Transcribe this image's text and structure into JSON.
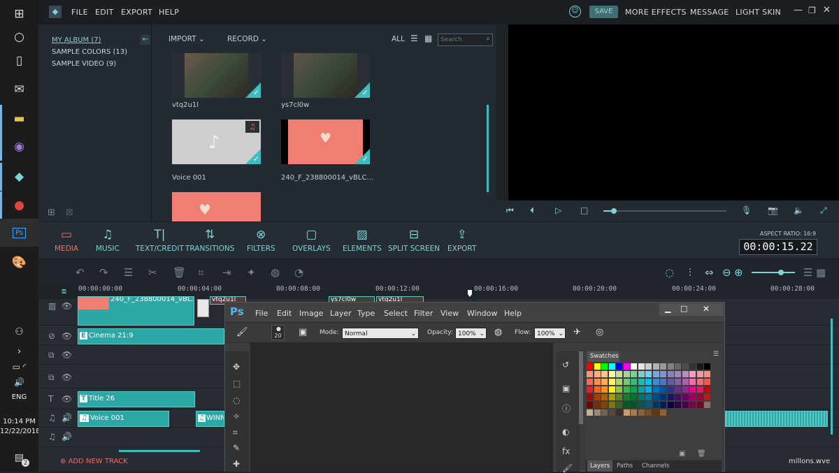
{
  "taskbar": {
    "lang": "ENG",
    "time": "10:14 PM",
    "date": "12/22/2018",
    "badge": "2"
  },
  "topbar": {
    "menus": [
      "FILE",
      "EDIT",
      "EXPORT",
      "HELP"
    ],
    "save": "SAVE",
    "more_effects": "MORE EFFECTS",
    "message": "MESSAGE",
    "light_skin": "LIGHT SKIN"
  },
  "album": {
    "items": [
      "MY ALBUM (7)",
      "SAMPLE COLORS (13)",
      "SAMPLE VIDEO (9)"
    ]
  },
  "media": {
    "import": "IMPORT",
    "record": "RECORD",
    "all": "ALL",
    "search_placeholder": "Search",
    "items": [
      {
        "caption": "vtq2u1l"
      },
      {
        "caption": "ys7cl0w"
      },
      {
        "caption": "Voice 001"
      },
      {
        "caption": "240_F_238800014_vBLC..."
      }
    ]
  },
  "tools": {
    "tabs": [
      "MEDIA",
      "MUSIC",
      "TEXT/CREDIT",
      "TRANSITIONS",
      "FILTERS",
      "OVERLAYS",
      "ELEMENTS",
      "SPLIT SCREEN",
      "EXPORT"
    ],
    "aspect_ratio": "ASPECT RATIO: 16:9",
    "timecode": "00:00:15.22"
  },
  "ruler": {
    "ticks": [
      "00:00:00:00",
      "00:00:04:00",
      "00:00:08:00",
      "00:00:12:00",
      "00:00:16:00",
      "00:00:20:00",
      "00:00:24:00",
      "00:00:28:00"
    ]
  },
  "clips": {
    "video1": "240_F_238800014_vBL...",
    "video1b": "vtq2u1l",
    "video1c": "ys7cl0w",
    "video1d": "vtq2u1l",
    "overlay": "Cinema 21:9",
    "title": "Title 26",
    "voice": "Voice 001",
    "music2": "WINN"
  },
  "add_track": "ADD NEW TRACK",
  "photoshop": {
    "logo": "Ps",
    "menus": [
      "File",
      "Edit",
      "Image",
      "Layer",
      "Type",
      "Select",
      "Filter",
      "View",
      "Window",
      "Help"
    ],
    "brush_size": "20",
    "mode_label": "Mode:",
    "mode_value": "Normal",
    "opacity_label": "Opacity:",
    "opacity_value": "100%",
    "flow_label": "Flow:",
    "flow_value": "100%",
    "swatches_tab": "Swatches",
    "layers_tabs": [
      "Layers",
      "Paths",
      "Channels"
    ]
  },
  "watermark": "millons.wve"
}
